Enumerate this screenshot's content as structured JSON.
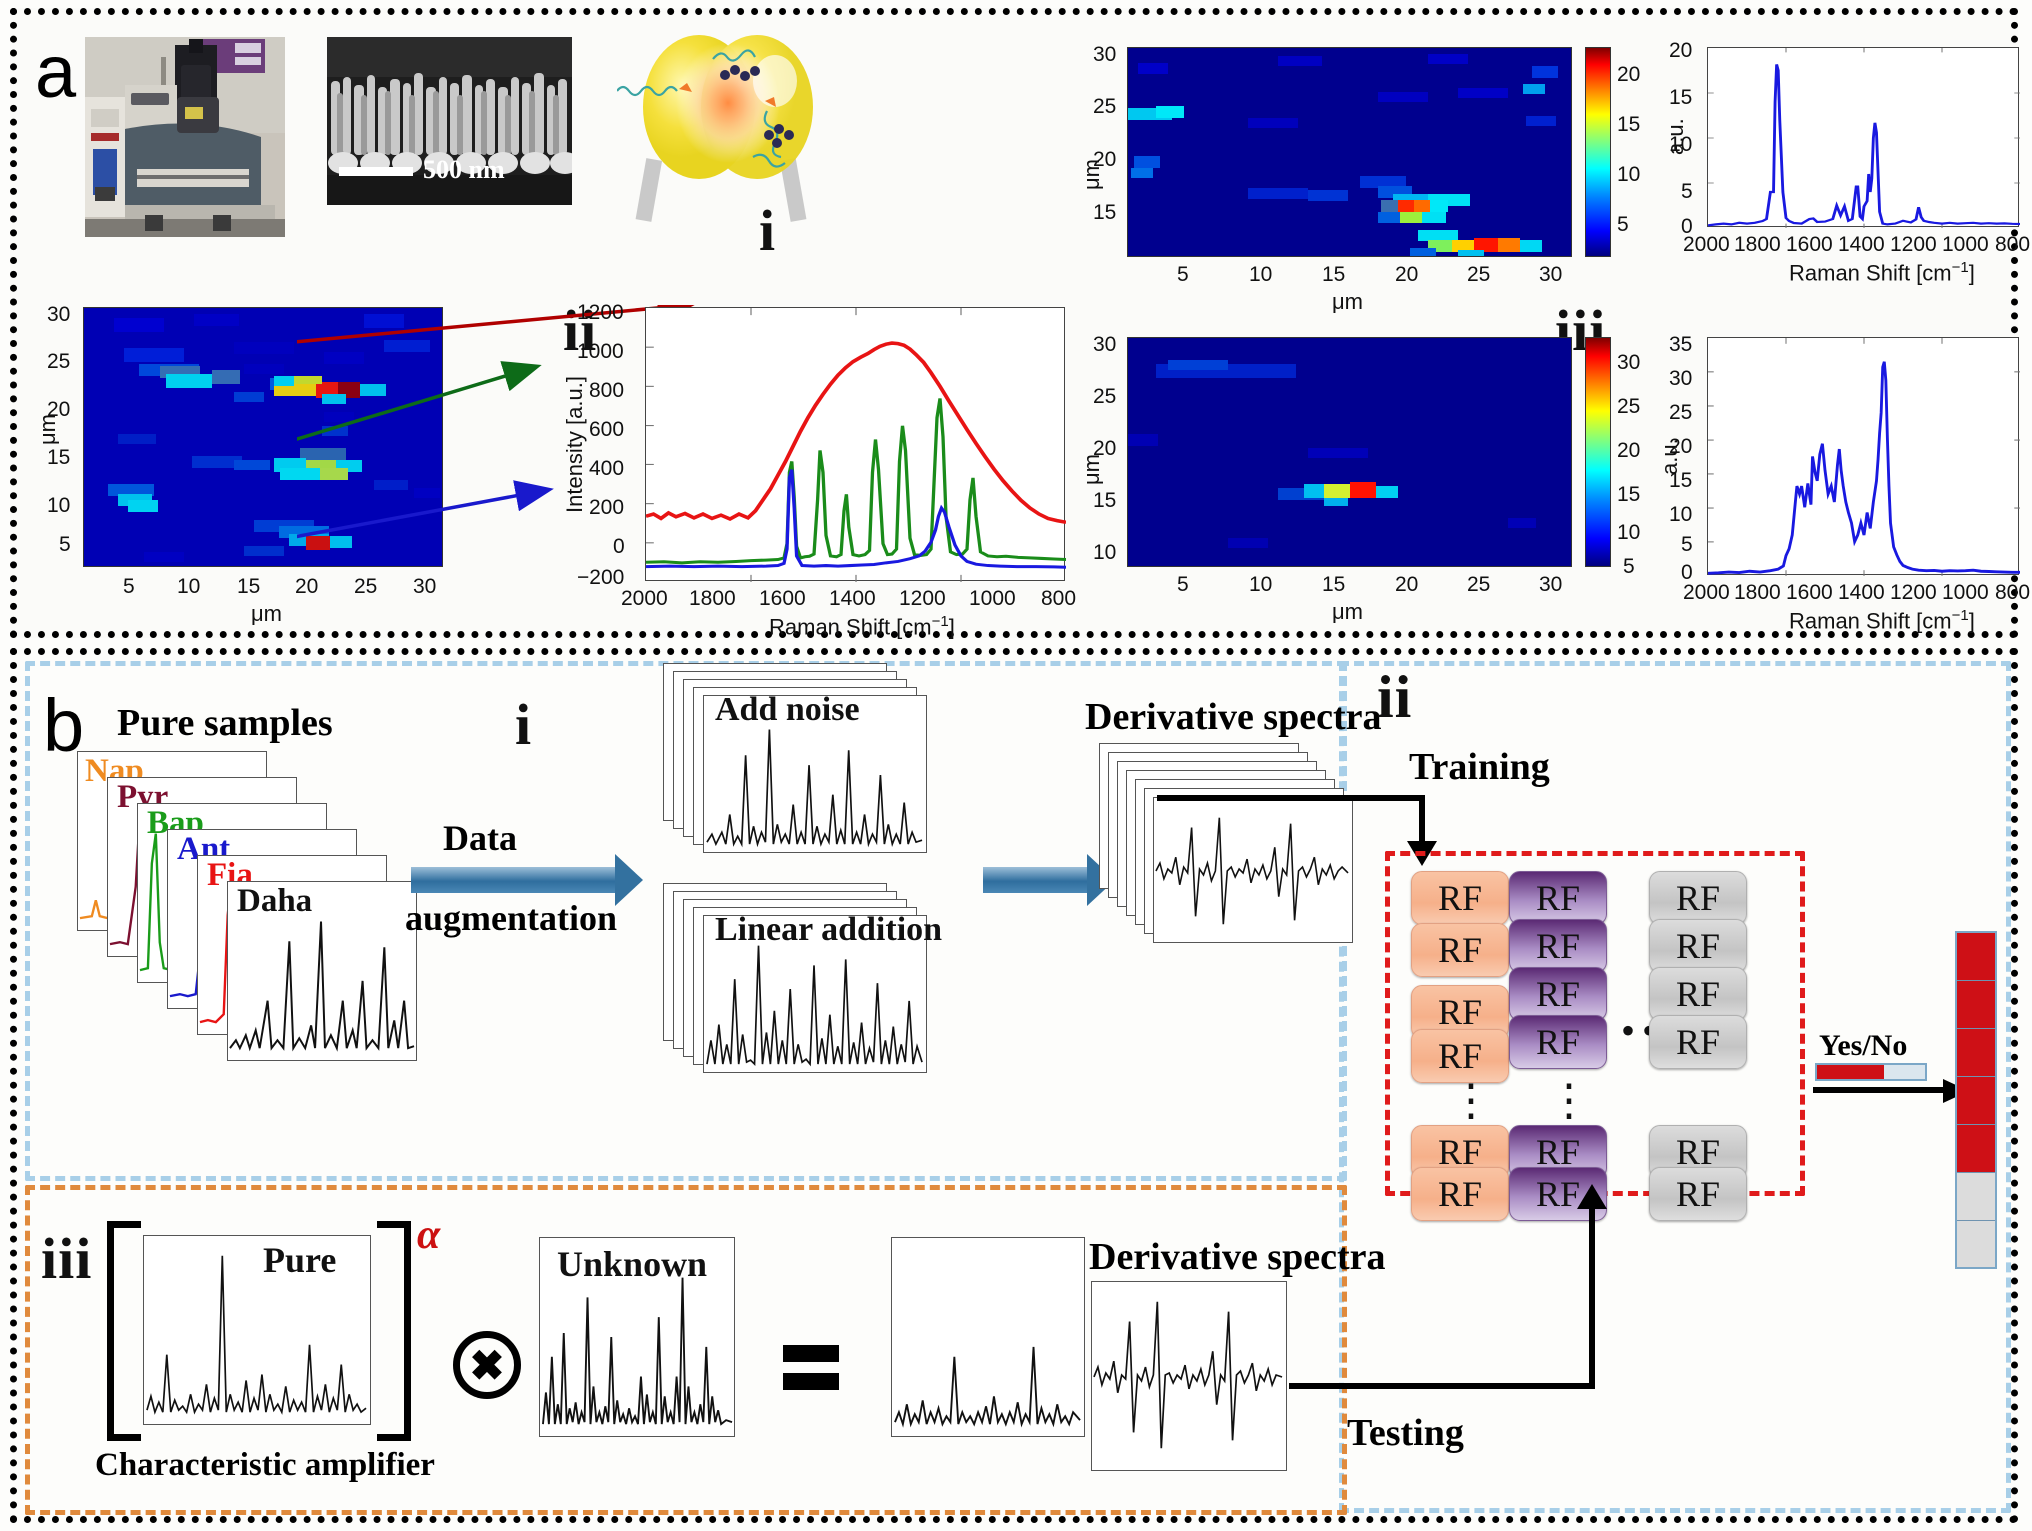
{
  "figure": {
    "panel_a_letter": "a",
    "panel_b_letter": "b"
  },
  "panel_a": {
    "roman_i": "i",
    "roman_ii": "ii",
    "roman_iii": "iii",
    "sem_scalebar_label": "500 nm",
    "heatmap_axis_label": "μm",
    "heatmap_ticks_x": [
      "5",
      "10",
      "15",
      "20",
      "25",
      "30"
    ],
    "heatmap_ticks_y": [
      "5",
      "10",
      "15",
      "20",
      "25",
      "30"
    ],
    "map_ii": {
      "name": "raman-map-ii",
      "colorbar_ticks": [],
      "axis_label": "μm"
    },
    "map_iii_top": {
      "name": "raman-map-iii-top",
      "colorbar_ticks": [
        "5",
        "10",
        "15",
        "20"
      ],
      "axis_label": "μm"
    },
    "map_iii_bottom": {
      "name": "raman-map-iii-bottom",
      "colorbar_ticks": [
        "5",
        "10",
        "15",
        "20",
        "25",
        "30"
      ],
      "axis_label": "μm"
    }
  },
  "panel_b": {
    "roman_i": "i",
    "roman_ii": "ii",
    "roman_iii": "iii",
    "pure_samples_title": "Pure samples",
    "sample_labels": [
      "Nap",
      "Pyr",
      "Bap",
      "Ant",
      "Fia",
      "Daha"
    ],
    "sample_colors": [
      "#ef8b21",
      "#7c1030",
      "#1a9c1a",
      "#1919cc",
      "#e81414",
      "#111111"
    ],
    "data_augmentation_line1": "Data",
    "data_augmentation_line2": "augmentation",
    "add_noise_title": "Add noise",
    "linear_addition_title": "Linear addition",
    "derivative_spectra_title_top": "Derivative spectra",
    "derivative_spectra_title_bottom": "Derivative spectra",
    "training_label": "Training",
    "testing_label": "Testing",
    "rf_label": "RF",
    "yes_no_label": "Yes/No",
    "pure_label": "Pure",
    "unknown_label": "Unknown",
    "characteristic_amplifier_label": "Characteristic amplifier",
    "alpha_exponent": "α",
    "result_cells": [
      "#ce1016",
      "#ce1016",
      "#ce1016",
      "#ce1016",
      "#ce1016",
      "#dcdcdc",
      "#dcdcdc"
    ],
    "yes_no_bar": {
      "filled_color": "#ce1016",
      "empty_color": "#dbe6ee",
      "filled_fraction": 0.62
    }
  },
  "chart_data": [
    {
      "name": "spectra-triple-ii",
      "type": "line",
      "title": "",
      "xlabel": "Raman Shift [cm⁻¹]",
      "ylabel": "Intensity [a.u.]",
      "xlim": [
        2000,
        800
      ],
      "ylim": [
        -200,
        1200
      ],
      "xticks": [
        2000,
        1800,
        1600,
        1400,
        1200,
        1000,
        800
      ],
      "yticks": [
        -200,
        0,
        200,
        400,
        600,
        800,
        1000,
        1200
      ],
      "grid": false,
      "series": [
        {
          "name": "red",
          "color": "#e81414",
          "x": [
            2000,
            1950,
            1900,
            1850,
            1800,
            1750,
            1700,
            1650,
            1600,
            1550,
            1500,
            1450,
            1400,
            1350,
            1300,
            1250,
            1200,
            1150,
            1100,
            1050,
            1000,
            950,
            900,
            850,
            800
          ],
          "values": [
            170,
            180,
            175,
            185,
            180,
            175,
            170,
            165,
            200,
            330,
            520,
            760,
            980,
            1100,
            1145,
            1120,
            1040,
            900,
            760,
            620,
            500,
            400,
            320,
            250,
            170
          ]
        },
        {
          "name": "green",
          "color": "#1a8c1a",
          "x": [
            2000,
            1950,
            1900,
            1850,
            1800,
            1750,
            1700,
            1650,
            1620,
            1600,
            1560,
            1520,
            1480,
            1440,
            1400,
            1360,
            1320,
            1280,
            1240,
            1200,
            1160,
            1120,
            1080,
            1040,
            1000,
            950,
            900,
            850,
            800
          ],
          "values": [
            25,
            30,
            25,
            30,
            28,
            25,
            30,
            40,
            120,
            330,
            120,
            420,
            110,
            250,
            120,
            330,
            120,
            520,
            140,
            700,
            170,
            300,
            120,
            130,
            90,
            70,
            60,
            55,
            50
          ]
        },
        {
          "name": "blue",
          "color": "#1919e0",
          "x": [
            2000,
            1900,
            1800,
            1700,
            1620,
            1600,
            1560,
            1500,
            1440,
            1400,
            1340,
            1300,
            1260,
            1220,
            1200,
            1160,
            1120,
            1080,
            1040,
            1000,
            950,
            900,
            850,
            800
          ],
          "values": [
            10,
            12,
            10,
            12,
            30,
            120,
            25,
            20,
            30,
            22,
            30,
            40,
            60,
            120,
            170,
            80,
            40,
            30,
            25,
            20,
            18,
            15,
            12,
            10
          ]
        }
      ]
    },
    {
      "name": "spectrum-iii-top",
      "type": "line",
      "title": "",
      "xlabel": "Raman Shift [cm⁻¹]",
      "ylabel": "a.u.",
      "xlim": [
        2000,
        800
      ],
      "ylim": [
        0,
        20
      ],
      "xticks": [
        2000,
        1800,
        1600,
        1400,
        1200,
        1000,
        800
      ],
      "yticks": [
        0,
        5,
        10,
        15,
        20
      ],
      "grid": false,
      "color": "#1919e0",
      "x": [
        2000,
        1950,
        1900,
        1850,
        1800,
        1750,
        1700,
        1660,
        1640,
        1620,
        1610,
        1600,
        1590,
        1580,
        1560,
        1540,
        1500,
        1460,
        1430,
        1400,
        1380,
        1350,
        1330,
        1310,
        1290,
        1270,
        1250,
        1240,
        1230,
        1220,
        1210,
        1200,
        1190,
        1170,
        1150,
        1100,
        1050,
        1000,
        950,
        900,
        880,
        860,
        840,
        820,
        800
      ],
      "values": [
        0.3,
        0.4,
        0.5,
        0.4,
        0.6,
        0.5,
        0.6,
        1.0,
        4.0,
        14.0,
        18.3,
        17.5,
        12.0,
        4.0,
        1.2,
        0.6,
        0.5,
        0.8,
        0.9,
        0.7,
        0.6,
        0.8,
        2.6,
        1.4,
        2.4,
        0.8,
        2.2,
        4.6,
        3.0,
        5.5,
        10.0,
        11.7,
        9.0,
        1.8,
        0.5,
        0.4,
        0.9,
        1.1,
        0.7,
        0.8,
        2.3,
        1.2,
        0.7,
        0.6,
        0.5
      ]
    },
    {
      "name": "spectrum-iii-bottom",
      "type": "line",
      "title": "",
      "xlabel": "Raman Shift [cm⁻¹]",
      "ylabel": "a.u.",
      "xlim": [
        2000,
        800
      ],
      "ylim": [
        0,
        35
      ],
      "xticks": [
        2000,
        1800,
        1600,
        1400,
        1200,
        1000,
        800
      ],
      "yticks": [
        0,
        5,
        10,
        15,
        20,
        25,
        30,
        35
      ],
      "grid": false,
      "color": "#1919e0",
      "x": [
        2000,
        1950,
        1900,
        1850,
        1800,
        1750,
        1700,
        1660,
        1620,
        1600,
        1580,
        1550,
        1520,
        1490,
        1460,
        1440,
        1420,
        1400,
        1380,
        1360,
        1340,
        1320,
        1300,
        1280,
        1260,
        1240,
        1230,
        1220,
        1210,
        1200,
        1190,
        1170,
        1150,
        1120,
        1100,
        1060,
        1020,
        980,
        940,
        900,
        860,
        820,
        800
      ],
      "values": [
        0.4,
        0.5,
        0.6,
        0.5,
        0.7,
        0.6,
        0.8,
        1.0,
        1.5,
        3.0,
        5.0,
        7.0,
        12.0,
        17.5,
        13.0,
        15.5,
        12.0,
        15.0,
        16.5,
        14.0,
        12.0,
        9.0,
        7.0,
        9.0,
        11.0,
        17.0,
        24.0,
        30.8,
        26.0,
        15.0,
        7.0,
        3.0,
        2.0,
        1.5,
        1.2,
        1.0,
        0.9,
        0.8,
        0.7,
        0.8,
        0.6,
        0.5,
        0.5
      ]
    }
  ]
}
